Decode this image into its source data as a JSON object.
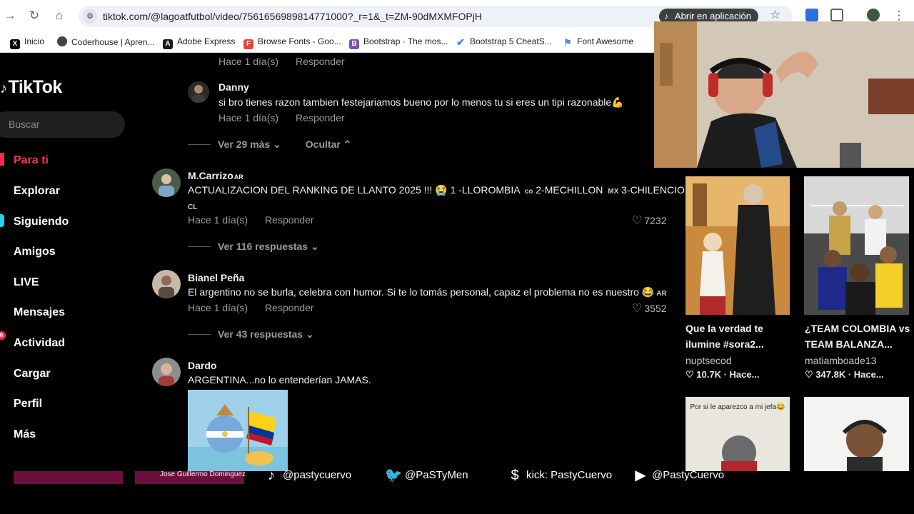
{
  "browser": {
    "url": "tiktok.com/@lagoatfutbol/video/7561656989814771000?_r=1&_t=ZM-90dMXMFOPjH",
    "open_in_app": "Abrir en aplicación",
    "bookmarks": [
      {
        "label": "Inicio",
        "icon": "x-icon",
        "color": "#000000"
      },
      {
        "label": "Coderhouse | Apren...",
        "icon": "coderhouse-icon",
        "color": "#444444"
      },
      {
        "label": "Adobe Express",
        "icon": "adobe-icon",
        "color": "#1a1a1a"
      },
      {
        "label": "Browse Fonts - Goo...",
        "icon": "google-fonts-icon",
        "color": "#e94235"
      },
      {
        "label": "Bootstrap · The mos...",
        "icon": "bootstrap-icon",
        "color": "#7952b3"
      },
      {
        "label": "Bootstrap 5 CheatS...",
        "icon": "check-icon",
        "color": "#3b82f6"
      },
      {
        "label": "Font Awesome",
        "icon": "flag-icon",
        "color": "#528dd7"
      }
    ]
  },
  "sidebar": {
    "logo": "TikTok",
    "search_placeholder": "Buscar",
    "items": [
      {
        "label": "Para ti",
        "color": "#fe2c55"
      },
      {
        "label": "Explorar",
        "color": "#ffffff"
      },
      {
        "label": "Siguiendo",
        "color": "#20d5ec"
      },
      {
        "label": "Amigos",
        "color": "#ffffff"
      },
      {
        "label": "LIVE",
        "color": "#ffffff"
      },
      {
        "label": "Mensajes",
        "color": "#ffffff"
      },
      {
        "label": "Actividad",
        "color": "#ffffff",
        "badge": "6"
      },
      {
        "label": "Cargar",
        "color": "#ffffff"
      },
      {
        "label": "Perfil",
        "color": "#ffffff"
      },
      {
        "label": "Más",
        "color": "#ffffff"
      }
    ]
  },
  "comments": {
    "top_meta": {
      "time": "Hace 1 día(s)",
      "reply": "Responder"
    },
    "danny": {
      "name": "Danny",
      "text": "si bro tienes razon tambien festejariamos bueno por lo menos tu si eres un tipi razonable💪",
      "time": "Hace 1 día(s)",
      "reply": "Responder"
    },
    "danny_more": {
      "more": "Ver 29 más",
      "hide": "Ocultar"
    },
    "carrizo": {
      "name": "M.Carrizo",
      "name_flag": "AR",
      "text": "ACTUALIZACION DEL RANKING DE LLANTO 2025 !!! 😭 1 -LLOROMBIA",
      "flag1": "co",
      "text2": "2-MECHILLON",
      "flag2": "MX",
      "text3": "3-CHILENCIO",
      "flag3": "CL",
      "time": "Hace 1 día(s)",
      "reply": "Responder",
      "likes": "7232",
      "replies": "Ver 116 respuestas"
    },
    "bianel": {
      "name": "Bianel Peña",
      "text": "El argentino no se burla, celebra con humor. Si te lo tomás personal, capaz el problema no es nuestro 😂",
      "flag": "AR",
      "time": "Hace 1 día(s)",
      "reply": "Responder",
      "likes": "3552",
      "replies": "Ver 43 respuestas"
    },
    "dardo": {
      "name": "Dardo",
      "text": "ARGENTINA...no lo entenderían JAMAS."
    }
  },
  "videos": [
    {
      "title": "Que la verdad te ilumine #sora2...",
      "user": "nuptsecod",
      "stats": "10.7K · Hace..."
    },
    {
      "title": "¿TEAM COLOMBIA vs TEAM BALANZA...",
      "user": "matiamboade13",
      "stats": "347.8K · Hace..."
    }
  ],
  "video_caption_3": "Por si le aparezco a mi jefa😂",
  "overlay": {
    "name": "Jose Guillermo Dominguez",
    "tiktok": "@pastycuervo",
    "twitter": "@PaSTyMen",
    "kick": "kick: PastyCuervo",
    "youtube": "@PastyCuervo",
    "bar_color": "#6b0f3c"
  }
}
